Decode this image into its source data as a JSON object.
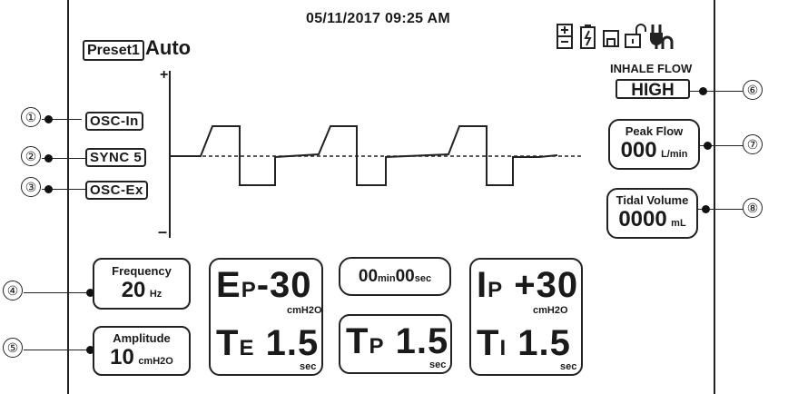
{
  "header": {
    "datetime": "05/11/2017 09:25 AM",
    "preset": "Preset1",
    "mode": "Auto"
  },
  "status_icons": [
    "battery-level-icon",
    "charging-icon",
    "save-icon",
    "unlock-icon",
    "power-plug-icon"
  ],
  "axis": {
    "plus": "+",
    "minus": "–"
  },
  "tags": {
    "osc_in": "OSC-In",
    "sync": "SYNC 5",
    "osc_ex": "OSC-Ex"
  },
  "callouts": [
    "①",
    "②",
    "③",
    "④",
    "⑤",
    "⑥",
    "⑦",
    "⑧"
  ],
  "inhale_flow": {
    "label": "INHALE FLOW",
    "value": "HIGH"
  },
  "peak_flow": {
    "label": "Peak Flow",
    "value": "000",
    "unit": "L/min"
  },
  "tidal_volume": {
    "label": "Tidal Volume",
    "value": "0000",
    "unit": "mL"
  },
  "frequency": {
    "label": "Frequency",
    "value": "20",
    "unit": "Hz"
  },
  "amplitude": {
    "label": "Amplitude",
    "value": "10",
    "unit": "cmH2O"
  },
  "ep": {
    "main": "E",
    "sub": "P",
    "value": "-30",
    "unit": "cmH2O"
  },
  "te": {
    "main": "T",
    "sub": "E",
    "value": "1.5",
    "unit": "sec"
  },
  "timer": {
    "min": "00",
    "min_unit": "min",
    "sec": "00",
    "sec_unit": "sec"
  },
  "tp": {
    "main": "T",
    "sub": "P",
    "value": "1.5",
    "unit": "sec"
  },
  "ip": {
    "main": "I",
    "sub": "P",
    "value": "+30",
    "unit": "cmH2O"
  },
  "ti": {
    "main": "T",
    "sub": "I",
    "value": "1.5",
    "unit": "sec"
  }
}
